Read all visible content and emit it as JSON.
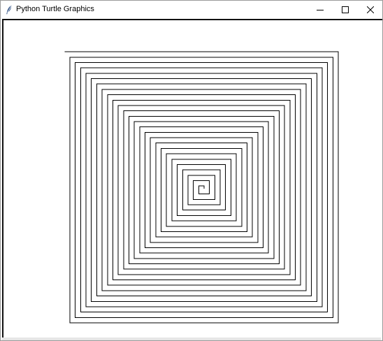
{
  "window": {
    "title": "Python Turtle Graphics",
    "icon": "feather-icon",
    "controls": {
      "minimize_icon": "minimize-icon",
      "maximize_icon": "maximize-icon",
      "close_icon": "close-icon"
    }
  },
  "canvas": {
    "background": "#ffffff",
    "pen_color": "#000000",
    "drawing": "square spiral"
  }
}
